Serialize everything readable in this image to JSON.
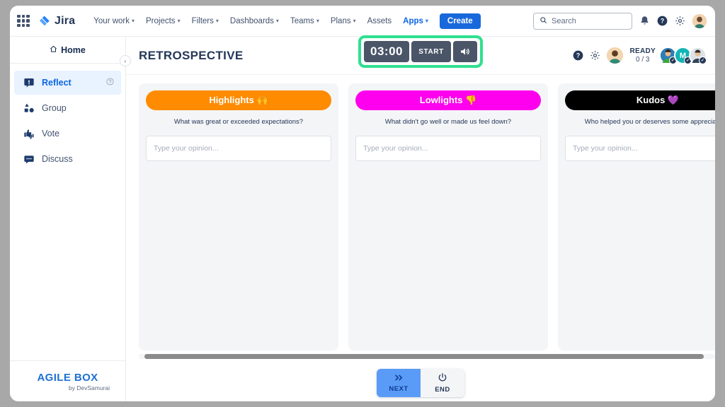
{
  "topnav": {
    "apps_grid_icon": "apps-grid-icon",
    "logo_text": "Jira",
    "items": [
      {
        "label": "Your work",
        "has_caret": true,
        "active": false
      },
      {
        "label": "Projects",
        "has_caret": true,
        "active": false
      },
      {
        "label": "Filters",
        "has_caret": true,
        "active": false
      },
      {
        "label": "Dashboards",
        "has_caret": true,
        "active": false
      },
      {
        "label": "Teams",
        "has_caret": true,
        "active": false
      },
      {
        "label": "Plans",
        "has_caret": true,
        "active": false
      },
      {
        "label": "Assets",
        "has_caret": false,
        "active": false
      },
      {
        "label": "Apps",
        "has_caret": true,
        "active": true
      }
    ],
    "create_label": "Create",
    "search_placeholder": "Search",
    "icons": [
      "notification-bell-icon",
      "help-icon",
      "settings-gear-icon",
      "profile-avatar"
    ]
  },
  "sidebar": {
    "home_label": "Home",
    "collapse_label": "‹",
    "items": [
      {
        "label": "Reflect",
        "icon": "reflect-icon",
        "active": true,
        "help": true
      },
      {
        "label": "Group",
        "icon": "group-icon",
        "active": false,
        "help": false
      },
      {
        "label": "Vote",
        "icon": "vote-icon",
        "active": false,
        "help": false
      },
      {
        "label": "Discuss",
        "icon": "discuss-icon",
        "active": false,
        "help": false
      }
    ],
    "brand_name": "AGILE BOX",
    "brand_sub": "by DevSamurai"
  },
  "header": {
    "title": "RETROSPECTIVE",
    "timer": {
      "time": "03:00",
      "start_label": "START",
      "sound_icon": "volume-icon",
      "highlight_color": "#2fe08f",
      "box_color": "#4a5568"
    },
    "help_icon": "help-icon",
    "settings_icon": "settings-gear-icon",
    "ready_label": "READY",
    "ready_count": "0 / 3",
    "participants": [
      {
        "initial": "",
        "color": "#2b7fb8",
        "ready": true
      },
      {
        "initial": "M",
        "color": "#11b5b5",
        "ready": true
      },
      {
        "initial": "",
        "color": "#d8dde3",
        "ready": true
      }
    ]
  },
  "board": {
    "columns": [
      {
        "title": "Highlights 🙌",
        "color": "#ff8b00",
        "subtitle": "What was great or exceeded expectations?",
        "input_placeholder": "Type your opinion..."
      },
      {
        "title": "Lowlights 👎",
        "color": "#ff00ee",
        "subtitle": "What didn't go well or made us feel down?",
        "input_placeholder": "Type your opinion..."
      },
      {
        "title": "Kudos 💜",
        "color": "#000000",
        "subtitle": "Who helped you or deserves some appreciation?",
        "input_placeholder": "Type your opinion..."
      }
    ]
  },
  "footer": {
    "next_label": "NEXT",
    "next_icon": "double-chevron-right-icon",
    "end_label": "END",
    "end_icon": "power-icon"
  }
}
